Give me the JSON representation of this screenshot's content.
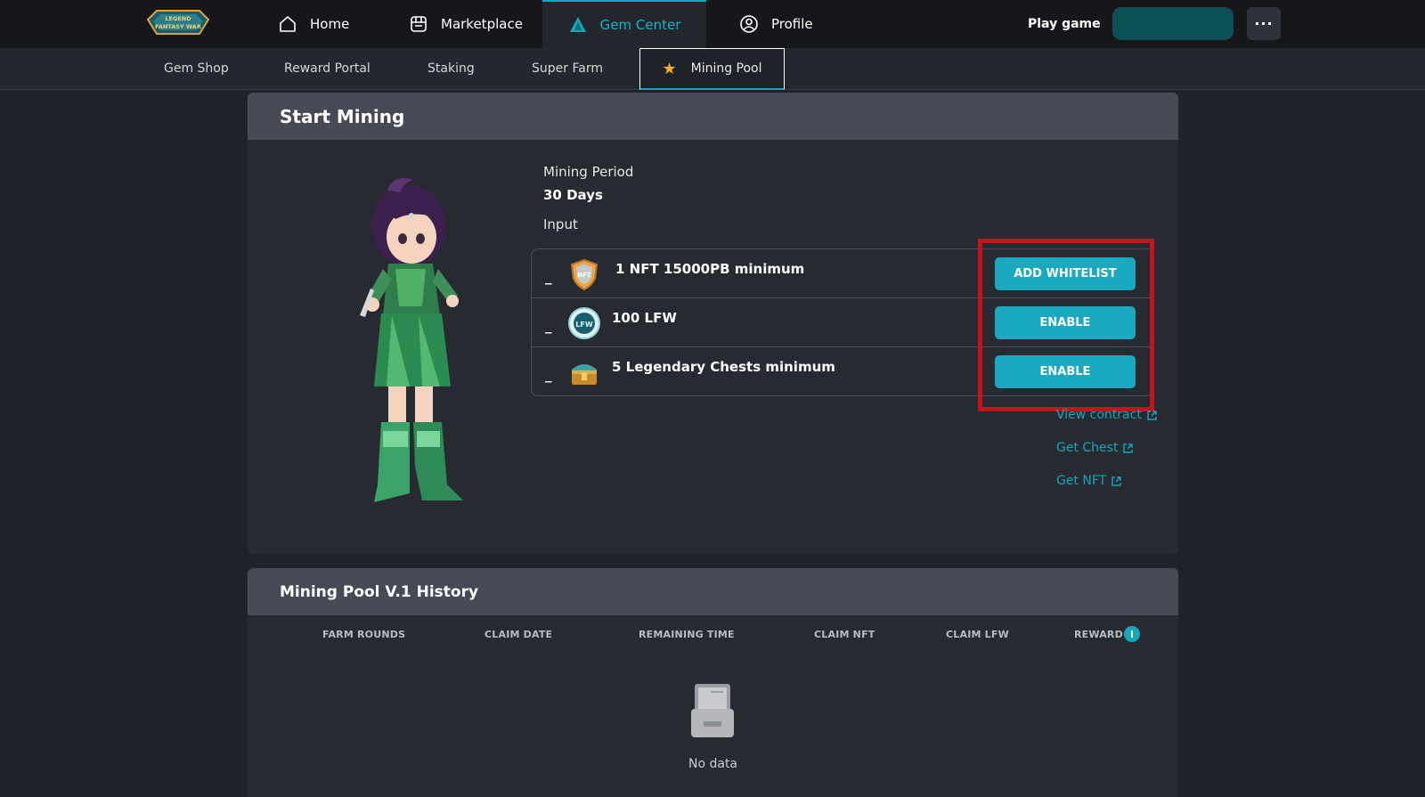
{
  "nav": {
    "logo_text": [
      "LEGEND",
      "FANTASY WAR"
    ],
    "items": [
      {
        "label": "Home",
        "icon": "home-icon"
      },
      {
        "label": "Marketplace",
        "icon": "store-icon"
      },
      {
        "label": "Gem Center",
        "icon": "gem-icon",
        "active": true
      },
      {
        "label": "Profile",
        "icon": "profile-icon"
      }
    ],
    "play_label": "Play game",
    "more_label": "···"
  },
  "subnav": {
    "items": [
      {
        "label": "Gem Shop"
      },
      {
        "label": "Reward Portal"
      },
      {
        "label": "Staking"
      },
      {
        "label": "Super Farm"
      },
      {
        "label": "Mining Pool",
        "active": true,
        "icon": "star-icon"
      }
    ]
  },
  "mining": {
    "title": "Start Mining",
    "period_label": "Mining Period",
    "period_value": "30 Days",
    "input_label": "Input",
    "inputs": [
      {
        "dash": "_",
        "text": "1 NFT 15000PB minimum",
        "icon": "nft-shield-icon",
        "button": "ADD WHITELIST"
      },
      {
        "dash": "_",
        "text": "100 LFW",
        "icon": "lfw-token-icon",
        "button": "ENABLE"
      },
      {
        "dash": "_",
        "text": "5 Legendary Chests minimum",
        "icon": "treasure-chest-icon",
        "button": "ENABLE"
      }
    ],
    "links": [
      "View contract",
      "Get Chest",
      "Get NFT"
    ]
  },
  "history": {
    "title": "Mining Pool V.1 History",
    "columns": [
      "FARM ROUNDS",
      "CLAIM DATE",
      "REMAINING TIME",
      "CLAIM NFT",
      "CLAIM LFW",
      "REWARD"
    ],
    "info_glyph": "i",
    "empty_text": "No data"
  },
  "colors": {
    "accent": "#1aa9bf",
    "highlight": "#c4141b",
    "nav_bg": "#15171b",
    "panel_head": "#474a55"
  }
}
